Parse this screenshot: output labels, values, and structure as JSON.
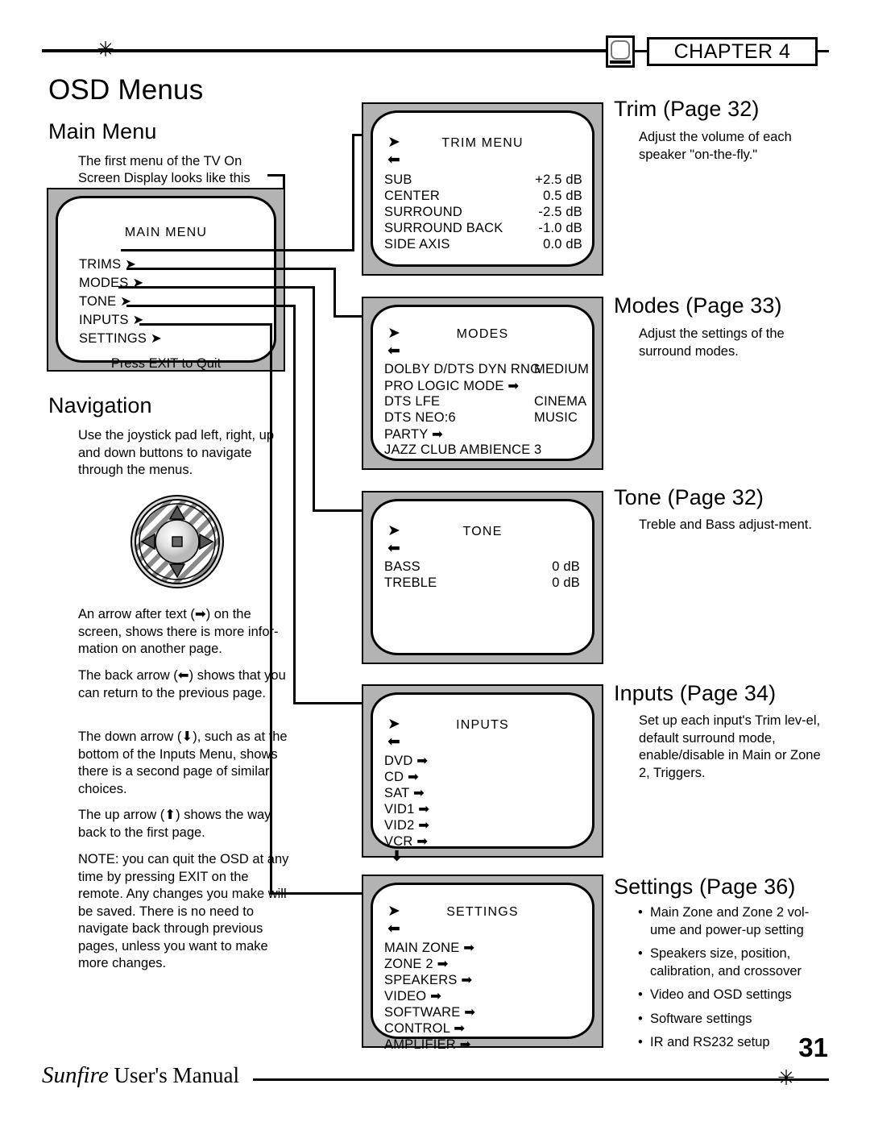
{
  "header": {
    "chapter_label": "CHAPTER 4",
    "page_title": "OSD Menus",
    "star_glyph": "✳"
  },
  "left": {
    "main_menu_heading": "Main Menu",
    "main_menu_caption_l1": "The first menu of the TV On",
    "main_menu_caption_l2": "Screen Display looks like this",
    "navigation_heading": "Navigation",
    "nav_intro": "Use the joystick pad left, right, up and down buttons to navigate through the menus.",
    "para_forward": "An arrow after text (➡) on the screen, shows there is more infor-mation on another page.",
    "para_back": "The back arrow (⬅) shows that you can return to the previous page.",
    "para_down": "The down arrow (⬇), such as at the bottom of the Inputs Menu, shows there is a second page of similar choices.",
    "para_up": "The up arrow (⬆) shows the way back to the first page.",
    "para_note": "NOTE: you can quit the OSD at any time by pressing EXIT on the remote. Any changes you make will be saved. There is no need to navigate back through previous pages, unless you want to make more changes."
  },
  "screens": {
    "main": {
      "title": "MAIN MENU",
      "items": [
        "TRIMS",
        "MODES",
        "TONE",
        "INPUTS",
        "SETTINGS"
      ],
      "footer": "Press EXIT to Quit"
    },
    "trim": {
      "title": "TRIM  MENU",
      "rows": [
        {
          "label": "SUB",
          "value": "+2.5 dB"
        },
        {
          "label": "CENTER",
          "value": "0.5 dB"
        },
        {
          "label": "SURROUND",
          "value": "-2.5 dB"
        },
        {
          "label": "SURROUND BACK",
          "value": "-1.0 dB"
        },
        {
          "label": "SIDE AXIS",
          "value": "0.0 dB"
        }
      ]
    },
    "modes": {
      "title": "MODES",
      "rows": [
        {
          "label": "DOLBY D/DTS DYN RNG",
          "value": "MEDIUM"
        },
        {
          "label": "PRO LOGIC MODE ➡",
          "value": ""
        },
        {
          "label": "DTS LFE",
          "value": "CINEMA"
        },
        {
          "label": "DTS NEO:6",
          "value": "MUSIC"
        },
        {
          "label": "PARTY ➡",
          "value": ""
        },
        {
          "label": "JAZZ CLUB AMBIENCE",
          "value": "3"
        }
      ]
    },
    "tone": {
      "title": "TONE",
      "rows": [
        {
          "label": "BASS",
          "value": "0  dB"
        },
        {
          "label": "TREBLE",
          "value": "0  dB"
        }
      ]
    },
    "inputs": {
      "title": "INPUTS",
      "rows": [
        {
          "label": "DVD ➡",
          "value": ""
        },
        {
          "label": "CD ➡",
          "value": ""
        },
        {
          "label": "SAT ➡",
          "value": ""
        },
        {
          "label": "VID1 ➡",
          "value": ""
        },
        {
          "label": "VID2 ➡",
          "value": ""
        },
        {
          "label": "VCR ➡",
          "value": ""
        }
      ],
      "more_glyph": "⬇"
    },
    "settings": {
      "title": "SETTINGS",
      "rows": [
        {
          "label": "MAIN ZONE ➡",
          "value": ""
        },
        {
          "label": "ZONE 2 ➡",
          "value": ""
        },
        {
          "label": "SPEAKERS ➡",
          "value": ""
        },
        {
          "label": "VIDEO ➡",
          "value": ""
        },
        {
          "label": "SOFTWARE ➡",
          "value": ""
        },
        {
          "label": "CONTROL ➡",
          "value": ""
        },
        {
          "label": "AMPLIFIER ➡",
          "value": ""
        }
      ]
    },
    "in_arrow": "➤",
    "back_arrow": "⬅"
  },
  "right": {
    "trim_heading": "Trim (Page 32)",
    "trim_body": "Adjust the volume of each speaker \"on-the-fly.\"",
    "modes_heading": "Modes (Page 33)",
    "modes_body": "Adjust the settings of the surround modes.",
    "tone_heading": "Tone (Page 32)",
    "tone_body": "Treble and Bass adjust-ment.",
    "inputs_heading": "Inputs (Page 34)",
    "inputs_body": "Set up each input's Trim lev-el, default surround mode, enable/disable in Main or Zone 2, Triggers.",
    "settings_heading": "Settings (Page 36)",
    "settings_bullets": [
      "Main Zone and Zone 2 vol-ume and power-up setting",
      "Speakers size, position, calibration, and crossover",
      "Video and OSD settings",
      "Software settings",
      "IR and RS232 setup"
    ]
  },
  "footer": {
    "page_number": "31",
    "brand": "Sunfire",
    "manual_label": "User's Manual",
    "star_glyph": "✳"
  }
}
